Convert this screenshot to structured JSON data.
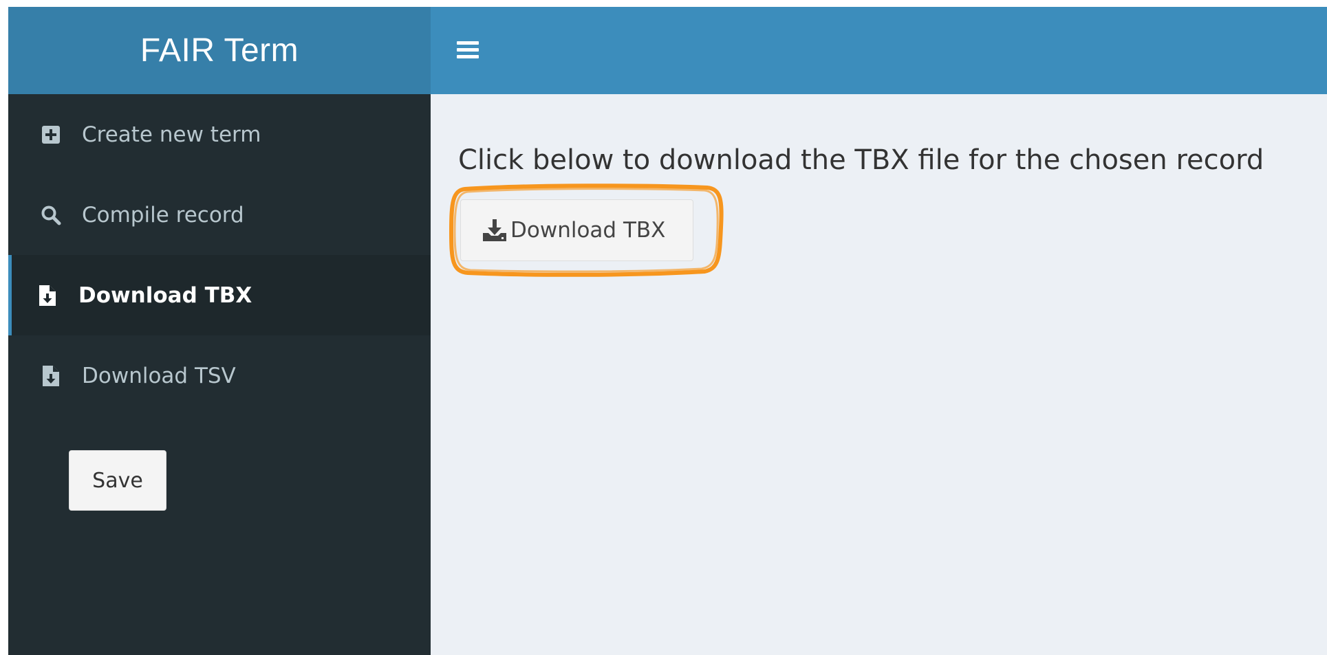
{
  "app": {
    "title": "FAIR Term"
  },
  "sidebar": {
    "items": [
      {
        "label": "Create new term",
        "icon": "plus-square-icon",
        "active": false
      },
      {
        "label": "Compile record",
        "icon": "search-icon",
        "active": false
      },
      {
        "label": "Download TBX",
        "icon": "file-download-icon",
        "active": true
      },
      {
        "label": "Download TSV",
        "icon": "file-download-icon",
        "active": false
      }
    ],
    "save_label": "Save"
  },
  "header": {
    "toggle_icon": "hamburger-menu-icon"
  },
  "main": {
    "instruction": "Click below to download the TBX file for the chosen record",
    "download_button": {
      "label": "Download TBX",
      "icon": "download-icon"
    }
  },
  "colors": {
    "brand_bar": "#367fa9",
    "top_bar": "#3c8dbc",
    "sidebar_bg": "#222d32",
    "sidebar_active_bg": "#1e282c",
    "content_bg": "#ecf0f5",
    "highlight": "#f7961e"
  }
}
